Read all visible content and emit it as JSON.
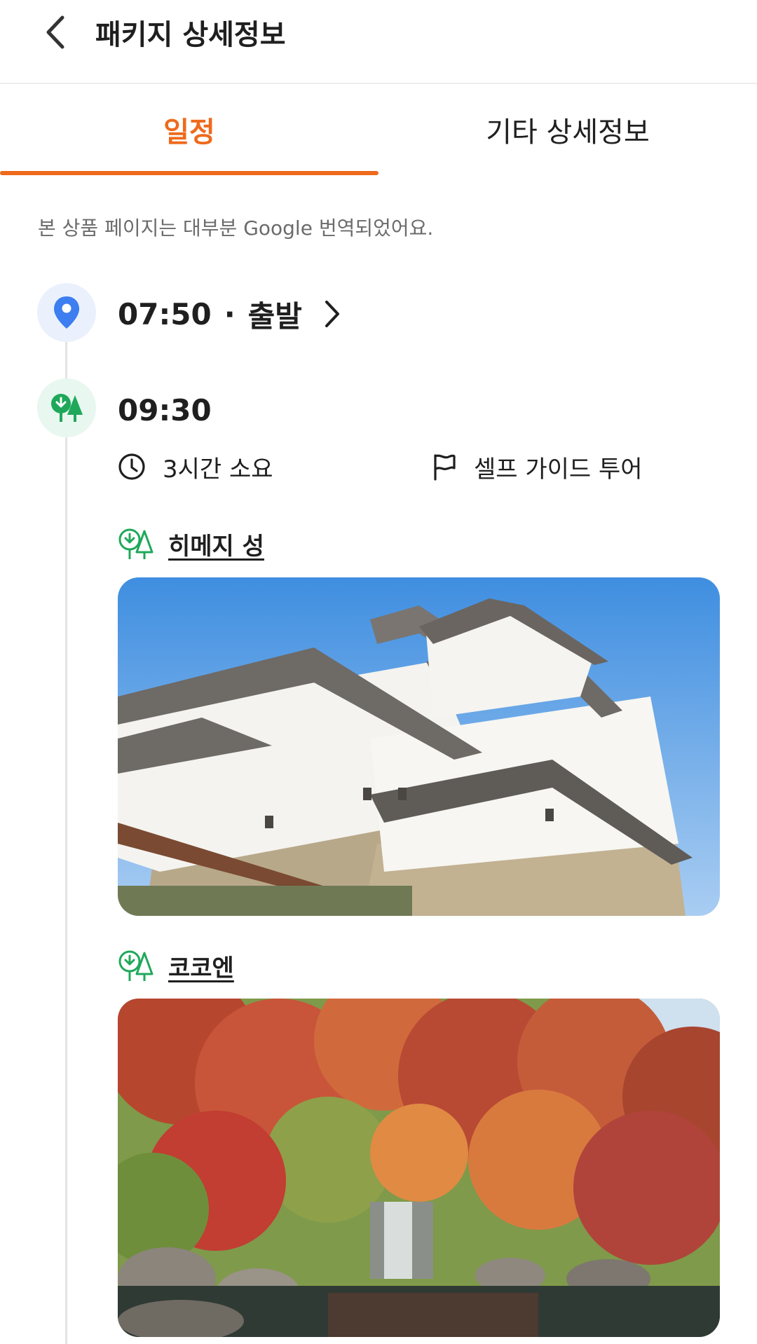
{
  "header": {
    "title": "패키지 상세정보",
    "back_icon": "chevron-left-icon"
  },
  "tabs": [
    {
      "label": "일정",
      "active": true
    },
    {
      "label": "기타 상세정보",
      "active": false
    }
  ],
  "notice": "본 상품 페이지는 대부분 Google 번역되었어요.",
  "timeline": {
    "start": {
      "time": "07:50",
      "separator": "·",
      "label": "출발",
      "icon": "map-pin-icon"
    },
    "spot": {
      "time": "09:30",
      "icon": "trees-icon",
      "duration": "3시간 소요",
      "duration_icon": "clock-icon",
      "guide": "셀프 가이드 투어",
      "guide_icon": "flag-icon",
      "places": [
        {
          "name": "히메지 성",
          "icon": "trees-icon"
        },
        {
          "name": "코코엔",
          "icon": "trees-icon"
        }
      ]
    }
  },
  "colors": {
    "accent": "#ee6a1c",
    "pin": "#3d7ef0",
    "tree": "#1fa85a",
    "text": "#1f1f1f",
    "muted": "#6b6b6b"
  }
}
